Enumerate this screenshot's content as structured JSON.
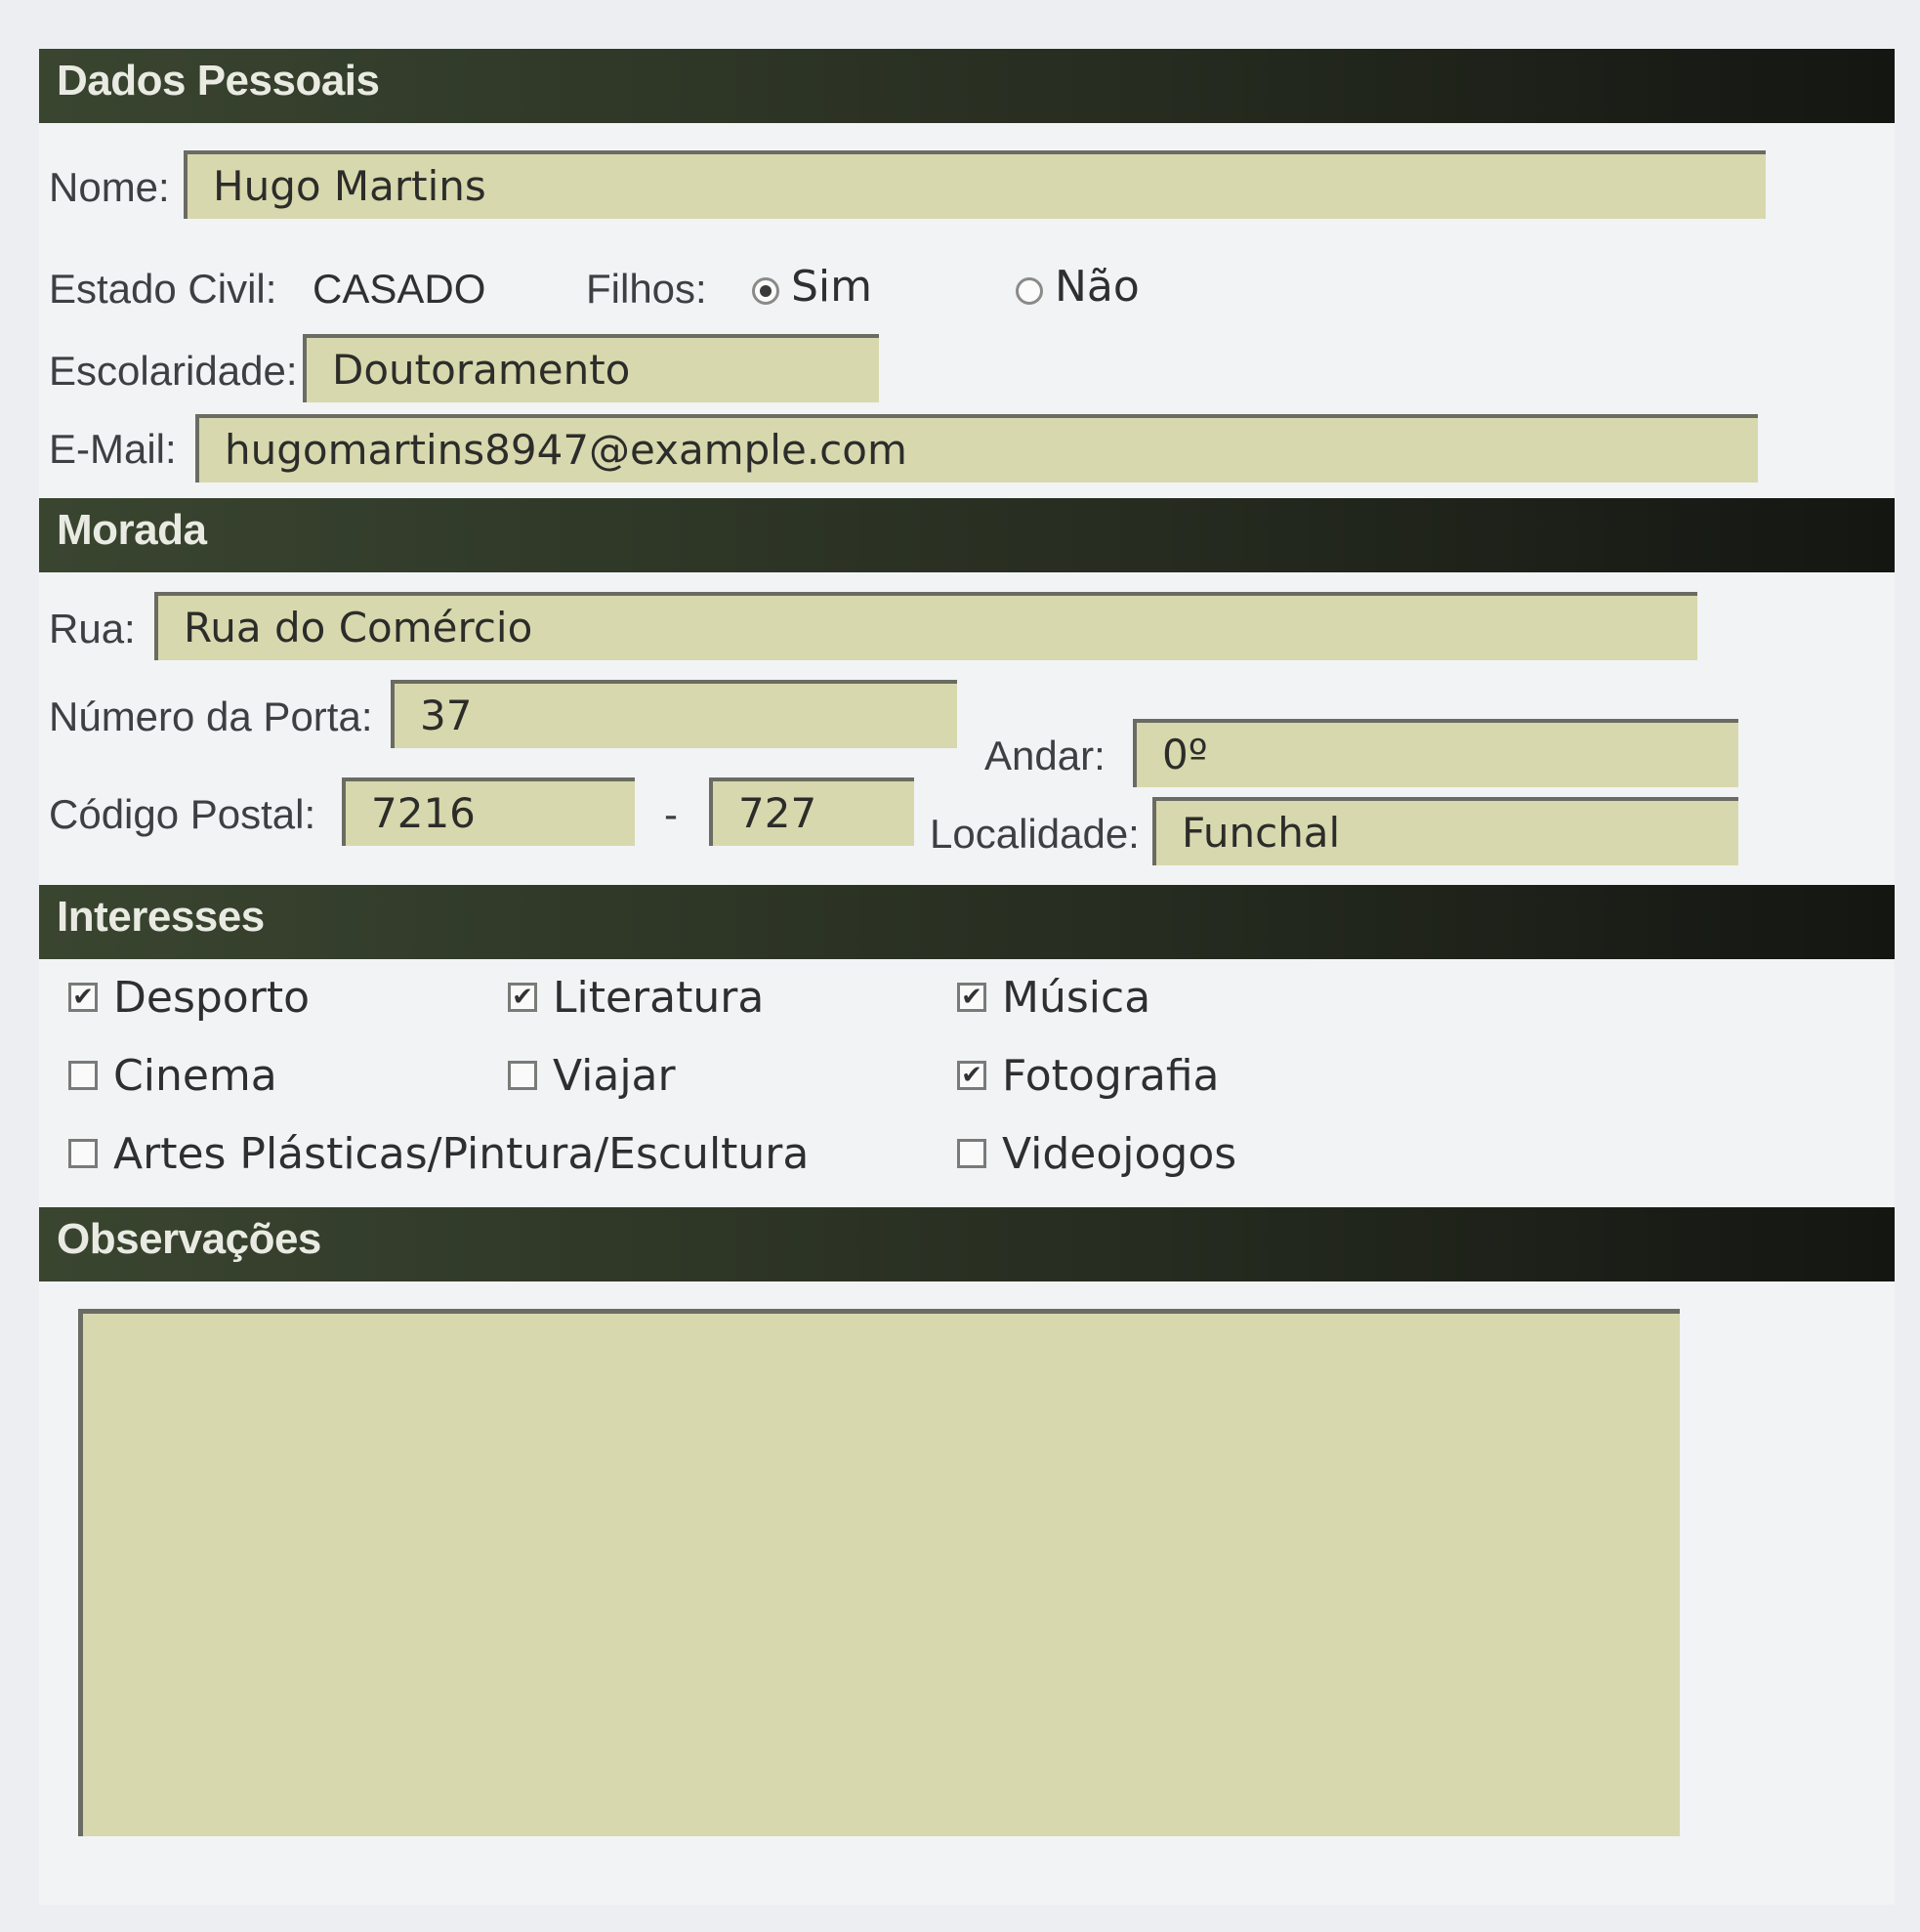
{
  "sections": {
    "dados_pessoais": "Dados Pessoais",
    "morada": "Morada",
    "interesses": "Interesses",
    "observacoes": "Observações"
  },
  "personal": {
    "nome_label": "Nome:",
    "nome_value": "Hugo Martins",
    "estado_civil_label": "Estado Civil:",
    "estado_civil_value": "CASADO",
    "filhos_label": "Filhos:",
    "filhos_options": [
      {
        "label": "Sim",
        "selected": true
      },
      {
        "label": "Não",
        "selected": false
      }
    ],
    "escolaridade_label": "Escolaridade:",
    "escolaridade_value": "Doutoramento",
    "email_label": "E-Mail:",
    "email_value": "hugomartins8947@example.com"
  },
  "address": {
    "rua_label": "Rua:",
    "rua_value": "Rua do Comércio",
    "numero_label": "Número da Porta:",
    "numero_value": "37",
    "andar_label": "Andar:",
    "andar_value": "0º",
    "codigo_label": "Código Postal:",
    "codigo_part1": "7216",
    "codigo_sep": "-",
    "codigo_part2": "727",
    "localidade_label": "Localidade:",
    "localidade_value": "Funchal"
  },
  "interests": [
    {
      "label": "Desporto",
      "checked": true
    },
    {
      "label": "Literatura",
      "checked": true
    },
    {
      "label": "Música",
      "checked": true
    },
    {
      "label": "Cinema",
      "checked": false
    },
    {
      "label": "Viajar",
      "checked": false
    },
    {
      "label": "Fotografia",
      "checked": true
    },
    {
      "label": "Artes Plásticas/Pintura/Escultura",
      "checked": false
    },
    {
      "label": "Videojogos",
      "checked": false
    }
  ],
  "observacoes_value": "",
  "colors": {
    "section_bar": "#262c20",
    "field_bg": "#d8d8ae"
  }
}
